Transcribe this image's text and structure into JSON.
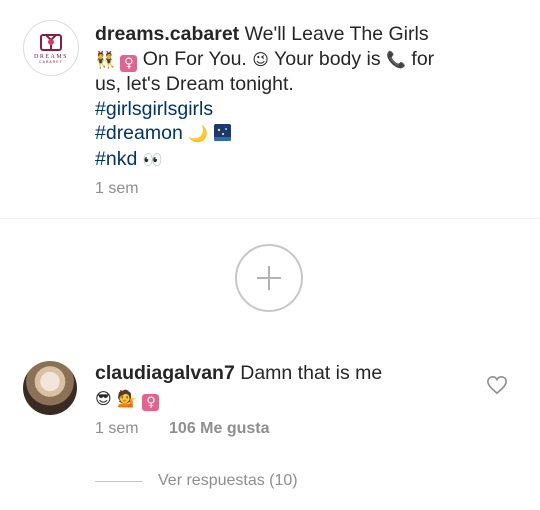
{
  "caption": {
    "avatar_brand": "DREAMS",
    "avatar_brand_sub": "CABARET",
    "username": "dreams.cabaret",
    "line1": "We'll Leave The Girls",
    "line2_emoji": "👯",
    "line2_female": "♀",
    "line2_text": "On For You.",
    "line2_wink": "😉",
    "line2_text2": "Your body is",
    "line2_phone": "📞",
    "line2_text3": "for",
    "line3": "us, let's Dream tonight.",
    "hashtags": [
      "#girlsgirlsgirls",
      "#dreamon",
      "#nkd"
    ],
    "hashtag2_emoji": "🌙",
    "hashtag3_emoji": "👀",
    "time": "1 sem"
  },
  "load_more": {
    "icon": "plus-icon"
  },
  "comment": {
    "username": "claudiagalvan7",
    "text": "Damn that is me",
    "emoji_cool": "😎",
    "emoji_woman": "💁",
    "emoji_female": "♀",
    "time": "1 sem",
    "likes": "106 Me gusta",
    "like_icon": "heart-outline-icon"
  },
  "replies": {
    "label": "Ver respuestas (10)"
  },
  "colors": {
    "hashtag": "#003569",
    "meta": "#8e8e8e",
    "text": "#262626",
    "female_badge": "#e4628d"
  }
}
